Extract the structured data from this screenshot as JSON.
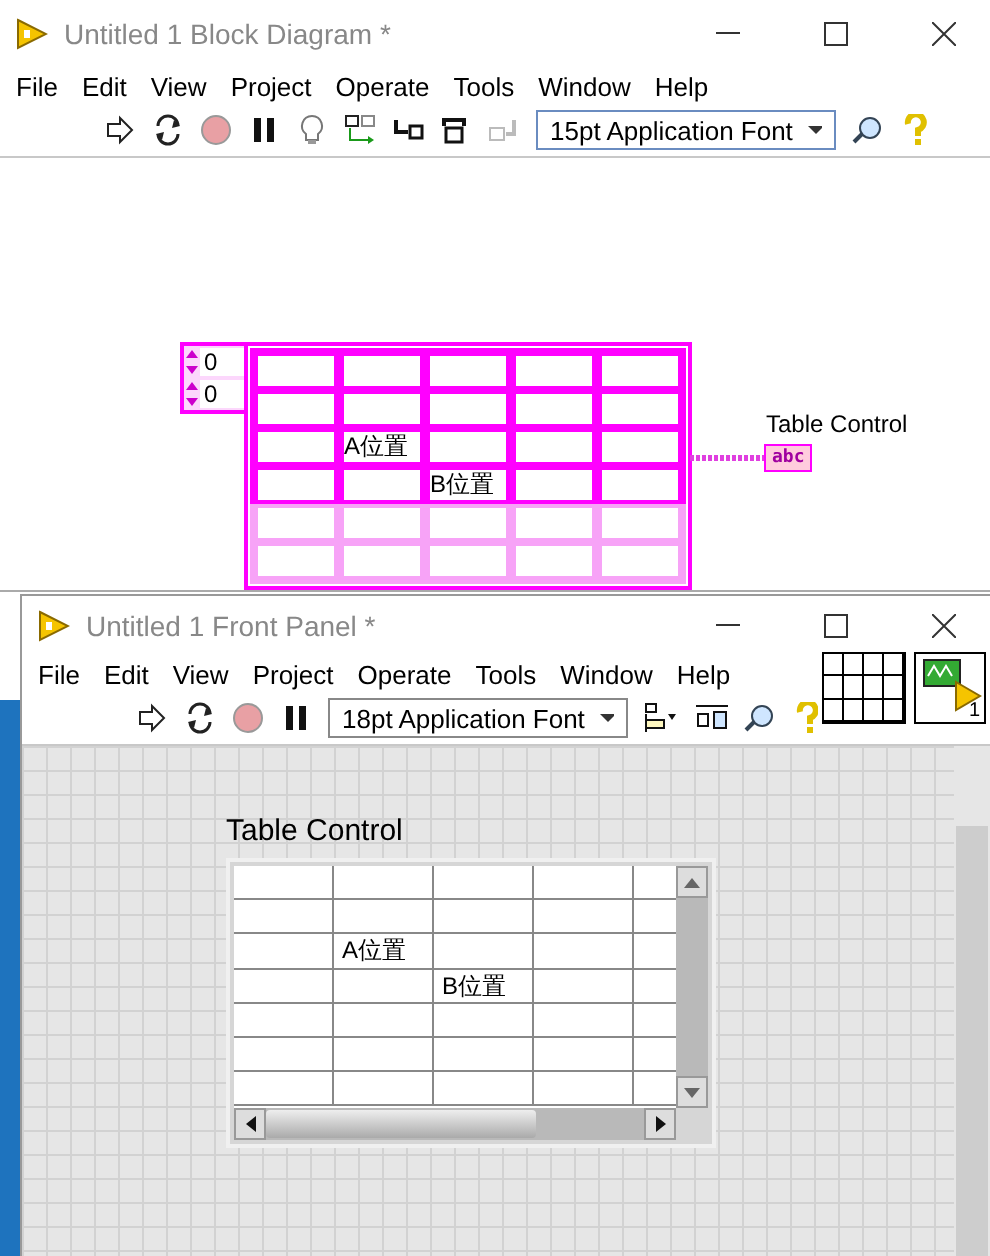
{
  "block_diagram": {
    "title": "Untitled 1 Block Diagram *",
    "menu": [
      "File",
      "Edit",
      "View",
      "Project",
      "Operate",
      "Tools",
      "Window",
      "Help"
    ],
    "font_selector": "15pt Application Font",
    "index_values": [
      "0",
      "0"
    ],
    "table_constant": {
      "rows": [
        {
          "in_use": true,
          "cells": [
            {},
            {},
            {},
            {},
            {}
          ]
        },
        {
          "in_use": true,
          "cells": [
            {},
            {},
            {},
            {},
            {}
          ]
        },
        {
          "in_use": true,
          "cells": [
            {},
            {
              "text": "A位置"
            },
            {},
            {},
            {}
          ]
        },
        {
          "in_use": true,
          "cells": [
            {},
            {},
            {
              "text": "B位置"
            },
            {},
            {}
          ]
        },
        {
          "in_use": false,
          "cells": [
            {},
            {},
            {},
            {},
            {}
          ]
        },
        {
          "in_use": false,
          "cells": [
            {},
            {},
            {},
            {},
            {}
          ]
        }
      ]
    },
    "terminal": {
      "label": "Table Control",
      "text": "abc"
    }
  },
  "front_panel": {
    "title": "Untitled 1 Front Panel *",
    "menu": [
      "File",
      "Edit",
      "View",
      "Project",
      "Operate",
      "Tools",
      "Window",
      "Help"
    ],
    "font_selector": "18pt Application Font",
    "connector_pane_number": "1",
    "table": {
      "label": "Table Control",
      "rows": [
        {
          "cells": [
            {},
            {},
            {},
            {},
            {}
          ]
        },
        {
          "cells": [
            {},
            {},
            {},
            {},
            {}
          ]
        },
        {
          "cells": [
            {},
            {
              "text": "A位置"
            },
            {},
            {},
            {}
          ]
        },
        {
          "cells": [
            {},
            {},
            {
              "text": "B位置"
            },
            {},
            {}
          ]
        },
        {
          "cells": [
            {},
            {},
            {},
            {},
            {}
          ]
        },
        {
          "cells": [
            {},
            {},
            {},
            {},
            {}
          ]
        },
        {
          "cells": [
            {},
            {},
            {},
            {},
            {}
          ]
        }
      ]
    }
  }
}
